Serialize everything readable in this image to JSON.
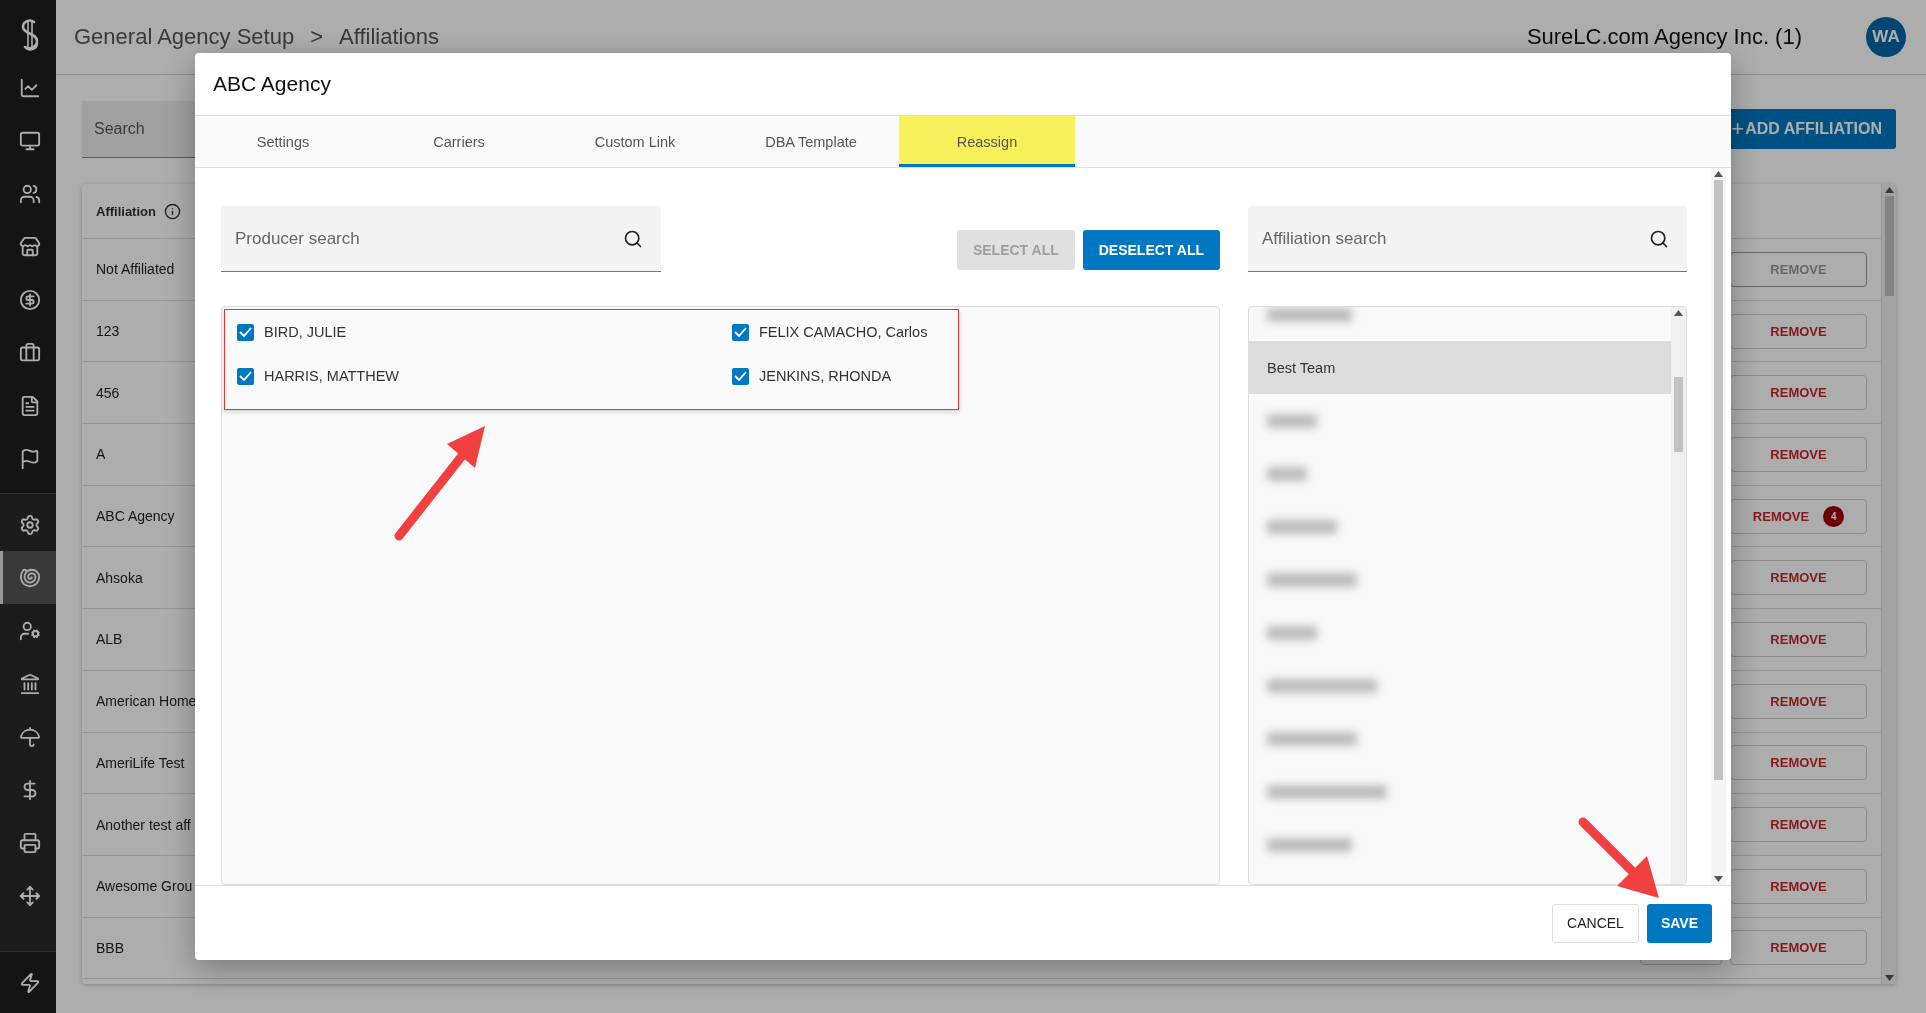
{
  "sidebar": {
    "groups": [
      {
        "items": [
          {
            "selected": false
          },
          {
            "selected": false
          },
          {
            "selected": false
          },
          {
            "selected": false
          },
          {
            "selected": false
          },
          {
            "selected": false
          },
          {
            "selected": false
          },
          {
            "selected": false
          },
          {
            "selected": false
          }
        ]
      },
      {
        "items": [
          {
            "selected": false
          },
          {
            "selected": true
          },
          {
            "selected": false
          },
          {
            "selected": false
          },
          {
            "selected": false
          },
          {
            "selected": false
          },
          {
            "selected": false
          },
          {
            "selected": false
          }
        ]
      },
      {
        "items": [
          {
            "selected": false
          }
        ]
      }
    ]
  },
  "breadcrumb": [
    "General Agency Setup",
    ">",
    "Affiliations"
  ],
  "account": {
    "name": "SureLC.com Agency Inc. (1)",
    "avatar": "WA"
  },
  "search": {
    "placeholder": "Search"
  },
  "add_button": {
    "icon": "+",
    "label": "ADD AFFILIATION"
  },
  "table": {
    "column": "Affiliation",
    "rows": [
      {
        "name": "Not Affiliated",
        "action": "REMOVE",
        "disabled": true
      },
      {
        "name": "123",
        "action": "REMOVE",
        "disabled": false
      },
      {
        "name": "456",
        "action": "REMOVE",
        "disabled": false
      },
      {
        "name": "A",
        "action": "REMOVE",
        "disabled": false
      },
      {
        "name": "ABC Agency",
        "action": "REMOVE",
        "disabled": false,
        "badge": "4"
      },
      {
        "name": "Ahsoka",
        "action": "REMOVE",
        "disabled": false
      },
      {
        "name": "ALB",
        "action": "REMOVE",
        "disabled": false
      },
      {
        "name": "American Home",
        "action": "REMOVE",
        "disabled": false
      },
      {
        "name": "AmeriLife Test",
        "action": "REMOVE",
        "disabled": false
      },
      {
        "name": "Another test aff",
        "action": "REMOVE",
        "disabled": false
      },
      {
        "name": "Awesome Grou",
        "action": "REMOVE",
        "disabled": false
      },
      {
        "name": "BBB",
        "action": "REMOVE",
        "disabled": false,
        "edit": true
      }
    ]
  },
  "dialog": {
    "title": "ABC Agency",
    "tabs": [
      {
        "label": "Settings",
        "selected": false
      },
      {
        "label": "Carriers",
        "selected": false
      },
      {
        "label": "Custom Link",
        "selected": false
      },
      {
        "label": "DBA Template",
        "selected": false
      },
      {
        "label": "Reassign",
        "selected": true
      }
    ],
    "producer_search": {
      "placeholder": "Producer search"
    },
    "select_all": {
      "label": "SELECT ALL",
      "disabled": true
    },
    "deselect_all": {
      "label": "DESELECT ALL",
      "disabled": false
    },
    "affiliation_search": {
      "placeholder": "Affiliation search"
    },
    "producers_highlighted": true,
    "producers": [
      {
        "name": "BIRD, JULIE",
        "checked": true
      },
      {
        "name": "FELIX CAMACHO, Carlos",
        "checked": true
      },
      {
        "name": "HARRIS, MATTHEW",
        "checked": true
      },
      {
        "name": "JENKINS, RHONDA",
        "checked": true
      }
    ],
    "affiliations": [
      {
        "kind": "redacted",
        "selected": false
      },
      {
        "kind": "text",
        "label": "Best Team",
        "selected": true
      },
      {
        "kind": "redacted",
        "selected": false
      },
      {
        "kind": "redacted",
        "selected": false
      },
      {
        "kind": "redacted",
        "selected": false
      },
      {
        "kind": "redacted",
        "selected": false
      },
      {
        "kind": "redacted",
        "selected": false
      },
      {
        "kind": "redacted",
        "selected": false
      },
      {
        "kind": "redacted",
        "selected": false
      },
      {
        "kind": "redacted",
        "selected": false
      },
      {
        "kind": "redacted",
        "selected": false
      }
    ],
    "buttons": [
      {
        "label": "CANCEL",
        "kind": "secondary"
      },
      {
        "label": "SAVE",
        "kind": "primary"
      }
    ]
  },
  "annotations": [
    {
      "kind": "arrow"
    },
    {
      "kind": "arrow"
    }
  ]
}
